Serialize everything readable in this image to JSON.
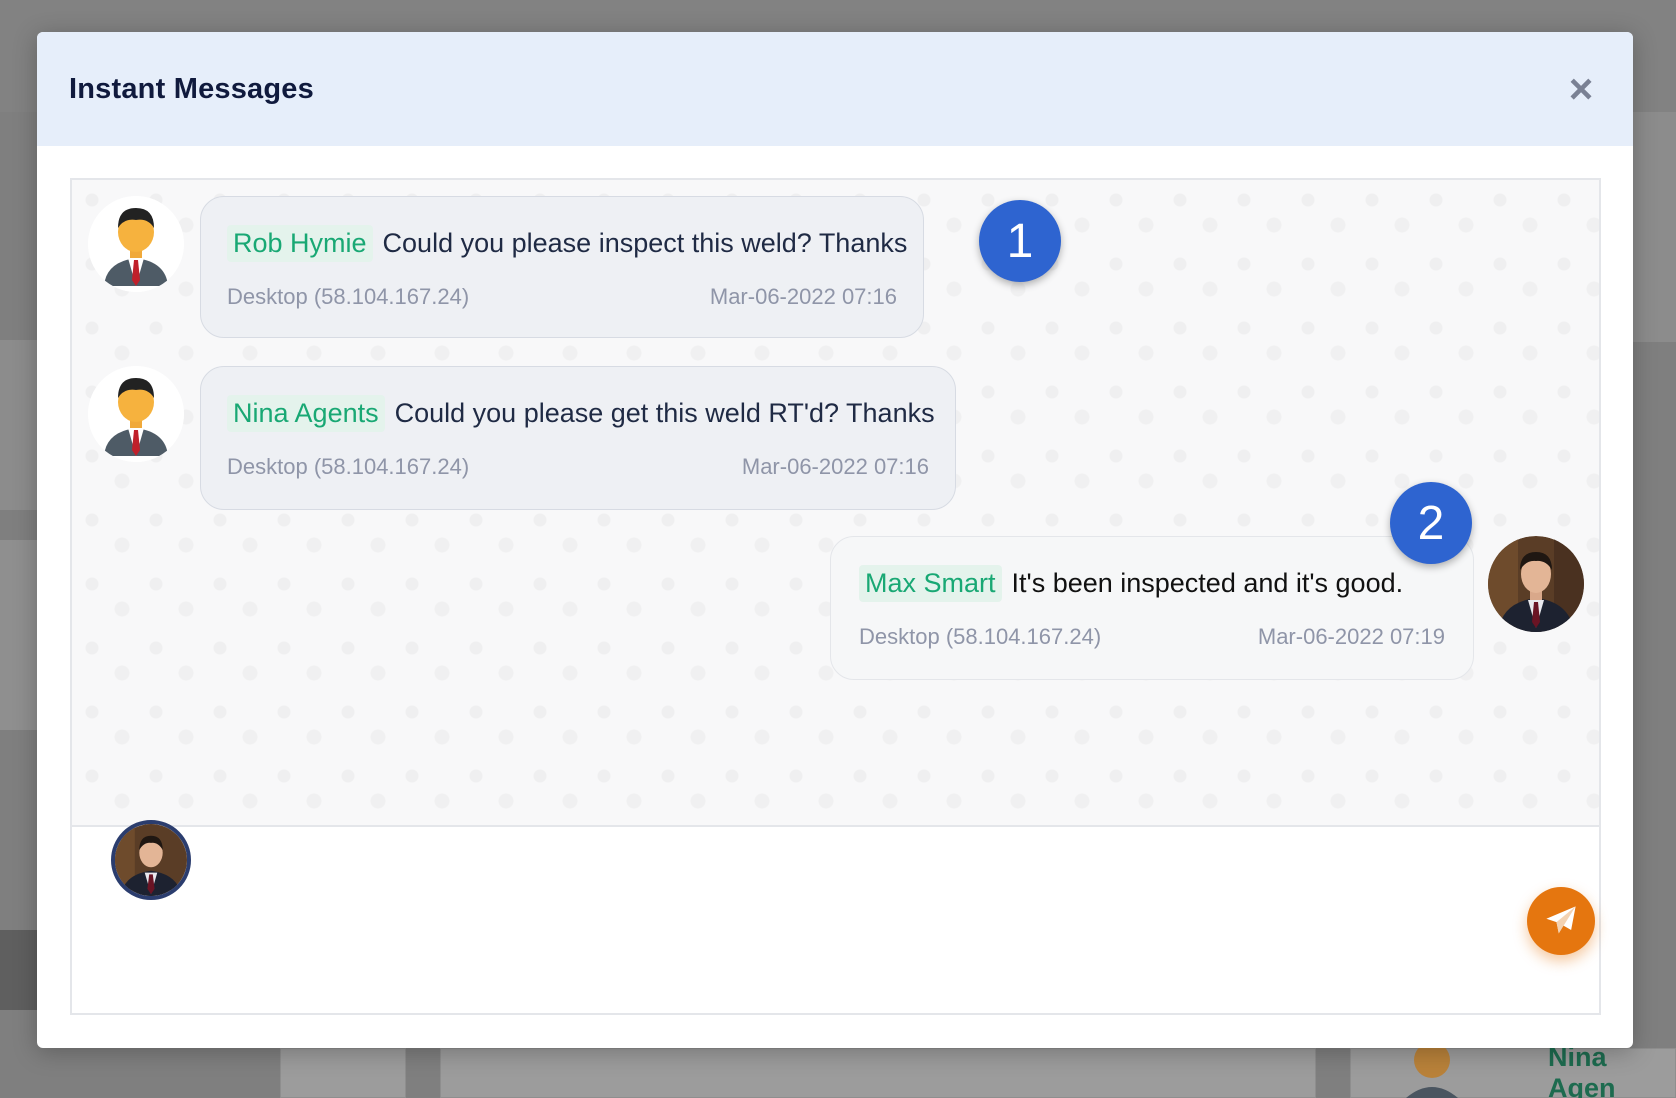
{
  "modal": {
    "title": "Instant Messages",
    "close_icon": "close-icon"
  },
  "messages": [
    {
      "sender": "Rob Hymie",
      "text": "Could you please inspect this weld? Thanks",
      "source": "Desktop (58.104.167.24)",
      "timestamp": "Mar-06-2022 07:16",
      "avatar_icon": "businessman-avatar-icon",
      "direction": "incoming"
    },
    {
      "sender": "Nina Agents",
      "text": "Could you please get this weld RT'd? Thanks",
      "source": "Desktop (58.104.167.24)",
      "timestamp": "Mar-06-2022 07:16",
      "avatar_icon": "businessman-avatar-icon",
      "direction": "incoming"
    },
    {
      "sender": "Max Smart",
      "text": "It's been inspected and it's good.",
      "source": "Desktop (58.104.167.24)",
      "timestamp": "Mar-06-2022 07:19",
      "avatar_icon": "user-photo-avatar",
      "direction": "outgoing"
    }
  ],
  "step_badges": [
    "1",
    "2"
  ],
  "composer": {
    "placeholder": "",
    "value": "",
    "send_icon": "paper-plane-icon"
  },
  "background": {
    "peek_name": "Nina Agen"
  },
  "colors": {
    "header_bg": "#e6eefa",
    "sender_name": "#19a874",
    "sender_chip_bg": "#e4f3ec",
    "badge_blue": "#2e64d0",
    "send_button": "#e5760f"
  }
}
